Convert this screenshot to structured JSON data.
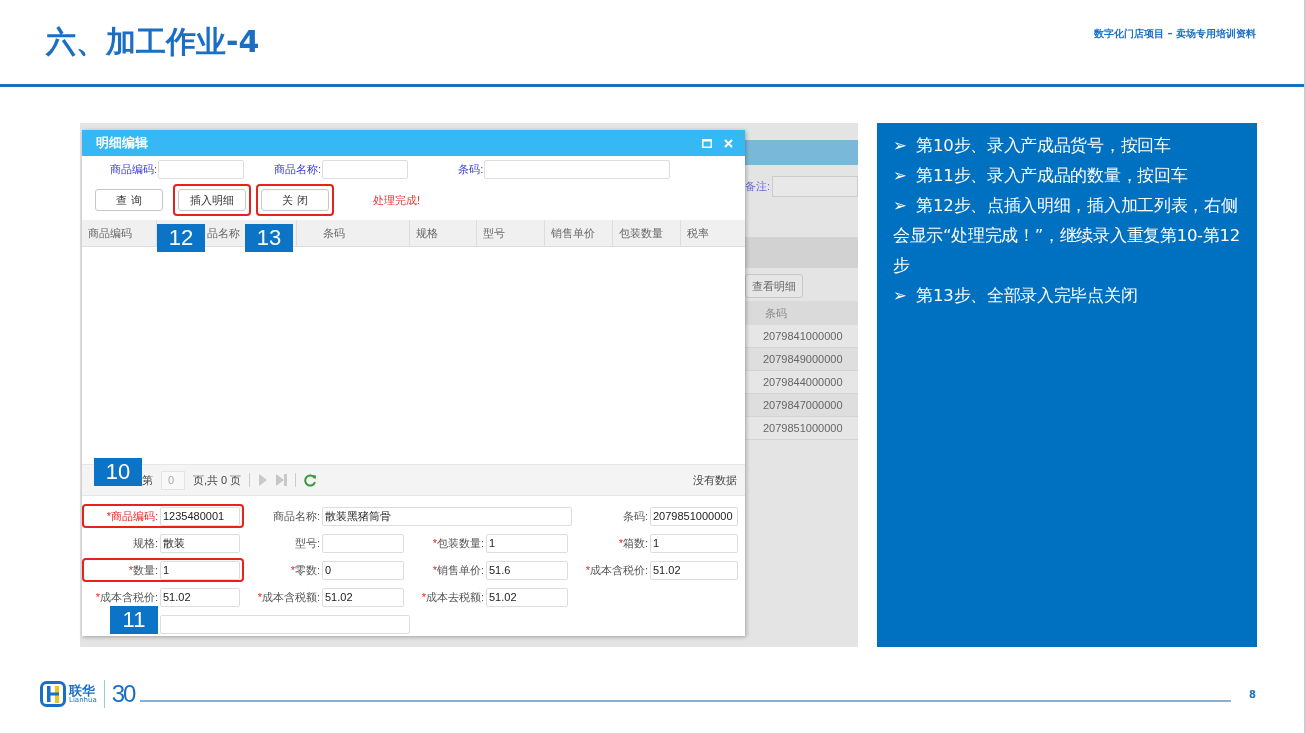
{
  "slide": {
    "title": "六、加工作业-4",
    "subtitle": "数字化门店项目 – 卖场专用培训资料",
    "page_number": "8"
  },
  "background_app": {
    "note_label": "备注:",
    "detail_button": "查看明细",
    "column": "条码",
    "rows": [
      "2079841000000",
      "2079849000000",
      "2079844000000",
      "2079847000000",
      "2079851000000"
    ]
  },
  "dialog": {
    "title": "明细编辑",
    "search": [
      {
        "label": "商品编码:"
      },
      {
        "label": "商品名称:"
      },
      {
        "label": "条码:"
      }
    ],
    "buttons": [
      {
        "label": "查 询",
        "highlighted": false
      },
      {
        "label": "插入明细",
        "highlighted": true,
        "badge": "12"
      },
      {
        "label": "关 闭",
        "highlighted": true,
        "badge": "13"
      }
    ],
    "message": "处理完成!",
    "columns": [
      {
        "label": "商品编码"
      },
      {
        "label": "品名称"
      },
      {
        "label": "条码"
      },
      {
        "label": "规格"
      },
      {
        "label": "型号"
      },
      {
        "label": "销售单价"
      },
      {
        "label": "包装数量"
      },
      {
        "label": "税率"
      }
    ],
    "pager": {
      "badge": "10",
      "page_label": "第",
      "page_value": "0",
      "total": "页,共 0 页",
      "status": "没有数据"
    },
    "form": [
      [
        {
          "marker": "*",
          "label": "商品编码:",
          "value": "1235480001",
          "highlighted": true,
          "red_label": true
        },
        {
          "label": "商品名称:",
          "value": "散装黑猪筒骨",
          "highlighted": false,
          "wide": true
        },
        {
          "label": "条码:",
          "value": "2079851000000",
          "highlighted": false
        }
      ],
      [
        {
          "label": "规格:",
          "value": "散装",
          "highlighted": false
        },
        {
          "label": "型号:",
          "highlighted": false
        },
        {
          "marker": "*",
          "label": "包装数量:",
          "value": "1",
          "highlighted": false
        },
        {
          "marker": "*",
          "label": "箱数:",
          "value": "1",
          "highlighted": false
        }
      ],
      [
        {
          "marker": "*",
          "label": "数量:",
          "value": "1",
          "highlighted": true
        },
        {
          "marker": "*",
          "label": "零数:",
          "value": "0",
          "highlighted": false
        },
        {
          "marker": "*",
          "label": "销售单价:",
          "value": "51.6",
          "highlighted": false
        },
        {
          "marker": "*",
          "label": "成本含税价:",
          "value": "51.02",
          "highlighted": false
        }
      ],
      [
        {
          "marker": "*",
          "label": "成本含税价:",
          "value": "51.02",
          "highlighted": false
        },
        {
          "marker": "*",
          "label": "成本含税额:",
          "value": "51.02",
          "highlighted": false
        },
        {
          "marker": "*",
          "label": "成本去税额:",
          "value": "51.02",
          "highlighted": false
        }
      ],
      [
        {
          "badge": "11",
          "highlighted": false,
          "wide": true
        }
      ]
    ]
  },
  "steps": [
    {
      "marker": "➢",
      "text": "第10步、录入产成品货号，按回车"
    },
    {
      "marker": "➢",
      "text": "第11步、录入产成品的数量，按回车"
    },
    {
      "marker": "➢",
      "text": "第12步、点插入明细，插入加工列表，右侧会显示“处理完成！”，继续录入重复第10-第12步"
    },
    {
      "marker": "➢",
      "text": "第13步、全部录入完毕点关闭"
    }
  ],
  "footer": {
    "brand_cn": "联华",
    "brand_en": "Lianhua",
    "anniversary": "30"
  }
}
